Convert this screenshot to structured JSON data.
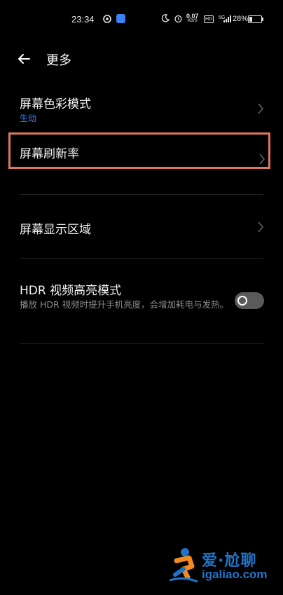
{
  "status_bar": {
    "time": "23:34",
    "net_speed_value": "0.07",
    "net_speed_unit": "KB/S",
    "hd_label": "HD",
    "signal_label": "5G",
    "battery_percent": "28%",
    "battery_level": 0.28
  },
  "header": {
    "title": "更多"
  },
  "settings": {
    "color_mode": {
      "title": "屏幕色彩模式",
      "value": "生动",
      "value_color": "#3b82f6"
    },
    "refresh_rate": {
      "title": "屏幕刷新率"
    },
    "display_area": {
      "title": "屏幕显示区域"
    },
    "hdr": {
      "title": "HDR 视频高亮模式",
      "description": "播放 HDR 视频时提升手机亮度，会增加耗电与发热。",
      "enabled": false
    }
  },
  "highlight_color": "#e07560",
  "watermark": {
    "text": "爱·尬聊",
    "url": "igaliao.com"
  }
}
